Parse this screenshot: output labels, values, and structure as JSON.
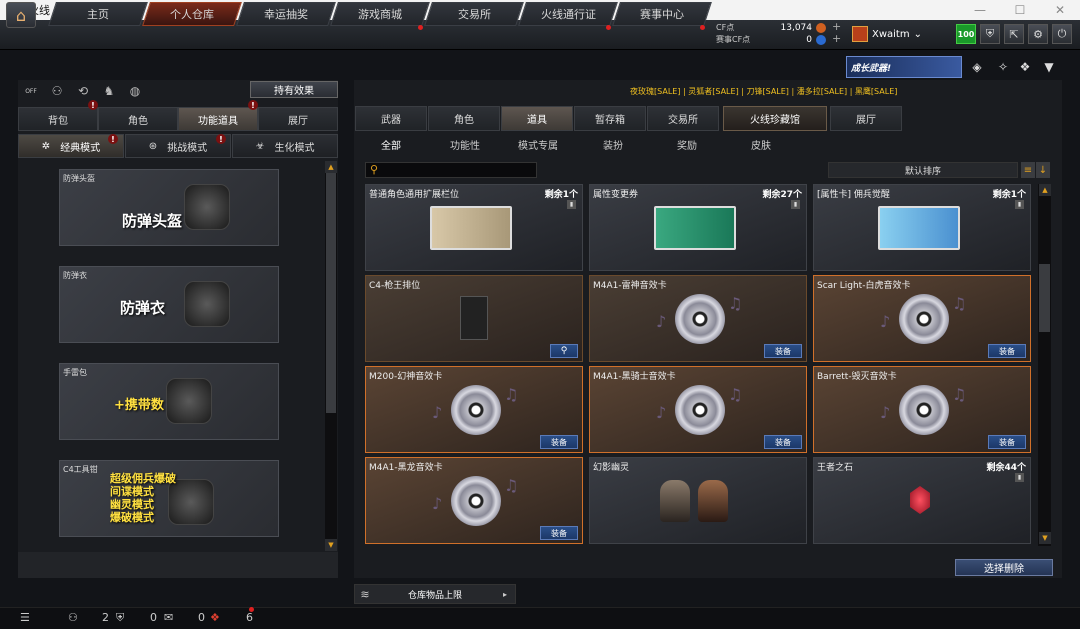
{
  "window": {
    "title": "穿越火线"
  },
  "topnav": {
    "tabs": [
      "主页",
      "个人仓库",
      "幸运抽奖",
      "游戏商城",
      "交易所",
      "火线通行证",
      "赛事中心"
    ],
    "active_tab": "个人仓库"
  },
  "currency": {
    "cf_label": "CF点",
    "cf_value": "13,074",
    "event_label": "赛事CF点",
    "event_value": "0"
  },
  "user": {
    "name": "Xwaitm",
    "level": "100"
  },
  "banner": {
    "text": "成长武器!"
  },
  "left": {
    "effect_button": "持有效果",
    "off_label": "OFF",
    "tabs": [
      "背包",
      "角色",
      "功能道具",
      "展厅"
    ],
    "active_tab": "功能道具",
    "mode_tabs": [
      "经典模式",
      "挑战模式",
      "生化模式"
    ],
    "active_mode": "经典模式",
    "cards": [
      {
        "label": "防弹头盔",
        "big": "防弹头盔"
      },
      {
        "label": "防弹衣",
        "big": "防弹衣"
      },
      {
        "label": "手雷包",
        "big": "+携带数"
      },
      {
        "label": "C4工具钳",
        "big": "超级佣兵爆破\n间谍模式\n幽灵模式\n爆破模式"
      }
    ]
  },
  "sales_line": "夜玫瑰[SALE]  |  灵狐者[SALE]  |  刀锋[SALE]  |  潘多拉[SALE]  |  黑鹰[SALE]",
  "right": {
    "tabs": [
      "武器",
      "角色",
      "道具",
      "暂存箱",
      "交易所",
      "火线珍藏馆",
      "展厅"
    ],
    "active_tab": "道具",
    "subtabs": [
      "全部",
      "功能性",
      "模式专属",
      "装扮",
      "奖励",
      "皮肤"
    ],
    "active_subtab": "全部",
    "sort_label": "默认排序",
    "equip_label": "装备",
    "items": [
      {
        "name": "普通角色通用扩展栏位",
        "count": "剩余1个"
      },
      {
        "name": "属性变更券",
        "count": "剩余27个"
      },
      {
        "name": "[属性卡] 佣兵觉醒",
        "count": "剩余1个"
      },
      {
        "name": "C4-枪王排位",
        "count": ""
      },
      {
        "name": "M4A1-雷神音效卡",
        "count": ""
      },
      {
        "name": "Scar Light-白虎音效卡",
        "count": ""
      },
      {
        "name": "M200-幻神音效卡",
        "count": ""
      },
      {
        "name": "M4A1-黑骑士音效卡",
        "count": ""
      },
      {
        "name": "Barrett-毁灭音效卡",
        "count": ""
      },
      {
        "name": "M4A1-黑龙音效卡",
        "count": ""
      },
      {
        "name": "幻影幽灵",
        "count": ""
      },
      {
        "name": "王者之石",
        "count": "剩余44个"
      }
    ],
    "delete_button": "选择删除",
    "capacity_button": "仓库物品上限"
  },
  "bottombar": {
    "friends": "2",
    "messages": "0",
    "gifts": "0",
    "notifications": "6"
  }
}
